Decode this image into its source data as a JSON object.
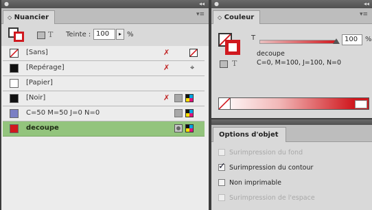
{
  "nuancier": {
    "title": "Nuancier",
    "tint_label": "Teinte :",
    "tint_value": "100",
    "percent": "%",
    "text_icon": "T",
    "swatches": [
      {
        "name": "[Sans]",
        "color": "none"
      },
      {
        "name": "[Repérage]",
        "color": "#111111"
      },
      {
        "name": "[Papier]",
        "color": "#ffffff"
      },
      {
        "name": "[Noir]",
        "color": "#111111"
      },
      {
        "name": "C=50 M=50 J=0 N=0",
        "color": "#7b7fc4"
      },
      {
        "name": "decoupe",
        "color": "#d0181e"
      }
    ]
  },
  "couleur": {
    "title": "Couleur",
    "text_icon": "T",
    "tint_value": "100",
    "percent": "%",
    "swatch_name": "decoupe",
    "values": "C=0, M=100, J=100, N=0"
  },
  "options": {
    "title": "Options d'objet",
    "items": [
      {
        "label": "Surimpression du fond",
        "checked": false,
        "enabled": false
      },
      {
        "label": "Surimpression du contour",
        "checked": true,
        "enabled": true
      },
      {
        "label": "Non imprimable",
        "checked": false,
        "enabled": true
      },
      {
        "label": "Surimpression de l'espace",
        "checked": false,
        "enabled": false
      }
    ]
  },
  "colors": {
    "selected_row": "#93c47d",
    "accent_red": "#d0181e"
  }
}
